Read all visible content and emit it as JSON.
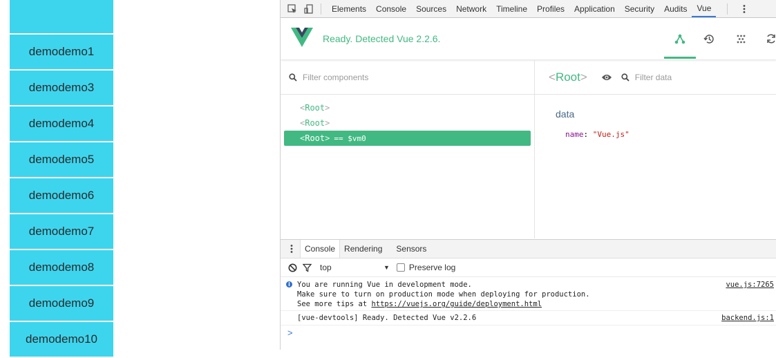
{
  "page_list": {
    "items": [
      "",
      "demodemo1",
      "demodemo3",
      "demodemo4",
      "demodemo5",
      "demodemo6",
      "demodemo7",
      "demodemo8",
      "demodemo9",
      "demodemo10"
    ]
  },
  "devtools": {
    "tabs": [
      "Elements",
      "Console",
      "Sources",
      "Network",
      "Timeline",
      "Profiles",
      "Application",
      "Security",
      "Audits",
      "Vue"
    ],
    "active_tab": "Vue"
  },
  "vue": {
    "status": "Ready. Detected Vue 2.2.6.",
    "accent": "#42b983",
    "tools": [
      "components-icon",
      "history-icon",
      "vuex-icon",
      "refresh-icon"
    ],
    "filter_components_placeholder": "Filter components",
    "tree": [
      {
        "name": "Root",
        "selected": false,
        "suffix": ""
      },
      {
        "name": "Root",
        "selected": false,
        "suffix": ""
      },
      {
        "name": "Root",
        "selected": true,
        "suffix": "== $vm0"
      }
    ],
    "inspector": {
      "title": "Root",
      "filter_data_placeholder": "Filter data",
      "section": "data",
      "key": "name",
      "value": "\"Vue.js\""
    }
  },
  "drawer": {
    "tabs": [
      "Console",
      "Rendering",
      "Sensors"
    ],
    "active_tab": "Console",
    "context": "top",
    "preserve_log": "Preserve log",
    "messages": [
      {
        "lines": [
          "You are running Vue in development mode.",
          "Make sure to turn on production mode when deploying for production.",
          "See more tips at "
        ],
        "link": "https://vuejs.org/guide/deployment.html",
        "source": "vue.js:7265"
      },
      {
        "text": "[vue-devtools] Ready. Detected Vue v2.2.6",
        "source": "backend.js:1"
      }
    ],
    "prompt": ">"
  }
}
